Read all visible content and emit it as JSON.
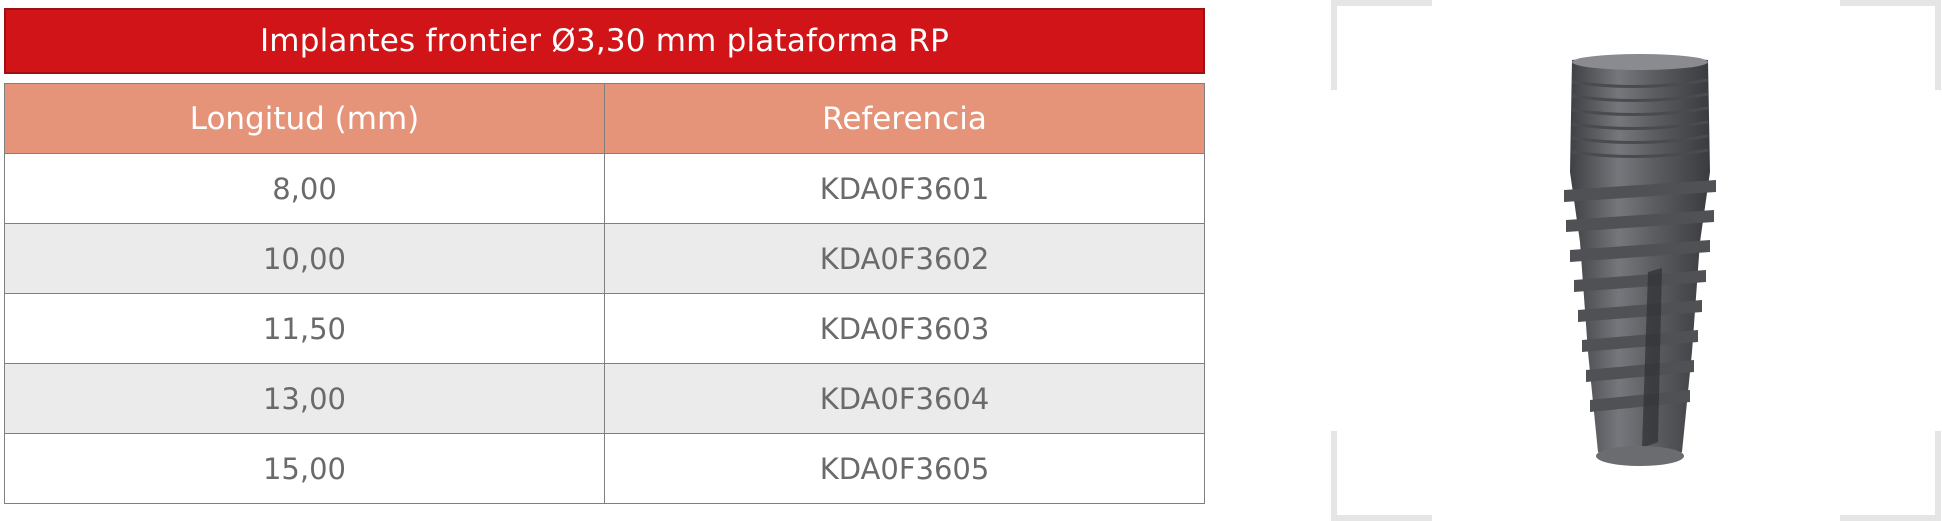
{
  "title": "Implantes frontier Ø3,30 mm plataforma RP",
  "table": {
    "headers": [
      "Longitud (mm)",
      "Referencia"
    ],
    "rows": [
      {
        "length": "8,00",
        "reference": "KDA0F3601"
      },
      {
        "length": "10,00",
        "reference": "KDA0F3602"
      },
      {
        "length": "11,50",
        "reference": "KDA0F3603"
      },
      {
        "length": "13,00",
        "reference": "KDA0F3604"
      },
      {
        "length": "15,00",
        "reference": "KDA0F3605"
      }
    ]
  },
  "product_image": {
    "icon": "dental-implant-icon"
  },
  "colors": {
    "title_bar": "#d11418",
    "header_row": "#e59379",
    "alt_row": "#ebebeb",
    "cell_text": "#6a6a6a",
    "frame": "#e5e5e5",
    "implant": "#5f6064"
  }
}
